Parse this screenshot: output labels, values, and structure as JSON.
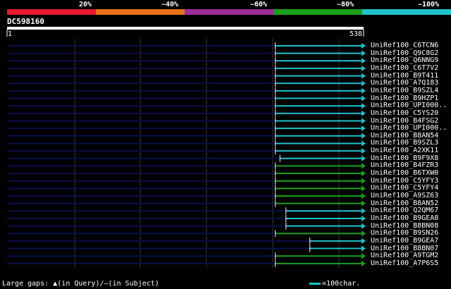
{
  "scale_labels": [
    "20%",
    "~40%",
    "~60%",
    "~80%",
    "~100%"
  ],
  "scale_colors": [
    "#e8162e",
    "#e8731a",
    "#9b2d9b",
    "#19a11b",
    "#1ec2c8"
  ],
  "query": {
    "name": "DC598160",
    "start": "1",
    "end": "538",
    "length": 538
  },
  "hits": [
    {
      "name": "UniRef100_C6TCN6",
      "start": 405,
      "end": 538,
      "identity_color": "#1ec2c8"
    },
    {
      "name": "UniRef100_Q9C8G2",
      "start": 405,
      "end": 538,
      "identity_color": "#1ec2c8"
    },
    {
      "name": "UniRef100_Q6NNG9",
      "start": 405,
      "end": 538,
      "identity_color": "#1ec2c8"
    },
    {
      "name": "UniRef100_C6T7V2",
      "start": 405,
      "end": 538,
      "identity_color": "#1ec2c8"
    },
    {
      "name": "UniRef100_B9T411",
      "start": 405,
      "end": 538,
      "identity_color": "#1ec2c8"
    },
    {
      "name": "UniRef100_A7Q183",
      "start": 405,
      "end": 538,
      "identity_color": "#1ec2c8"
    },
    {
      "name": "UniRef100_B9SZL4",
      "start": 405,
      "end": 538,
      "identity_color": "#1ec2c8"
    },
    {
      "name": "UniRef100_B9HZP1",
      "start": 405,
      "end": 538,
      "identity_color": "#1ec2c8"
    },
    {
      "name": "UniRef100_UPI000..",
      "start": 405,
      "end": 538,
      "identity_color": "#1ec2c8"
    },
    {
      "name": "UniRef100_C5YS20",
      "start": 405,
      "end": 538,
      "identity_color": "#1ec2c8"
    },
    {
      "name": "UniRef100_B4FSG2",
      "start": 405,
      "end": 538,
      "identity_color": "#1ec2c8"
    },
    {
      "name": "UniRef100_UPI000..",
      "start": 405,
      "end": 538,
      "identity_color": "#1ec2c8"
    },
    {
      "name": "UniRef100_B8AN54",
      "start": 405,
      "end": 538,
      "identity_color": "#1ec2c8"
    },
    {
      "name": "UniRef100_B9SZL3",
      "start": 405,
      "end": 538,
      "identity_color": "#1ec2c8"
    },
    {
      "name": "UniRef100_A2XK11",
      "start": 405,
      "end": 538,
      "identity_color": "#1ec2c8"
    },
    {
      "name": "UniRef100_B9F9X8",
      "start": 412,
      "end": 538,
      "identity_color": "#1ec2c8"
    },
    {
      "name": "UniRef100_B4FZR3",
      "start": 405,
      "end": 538,
      "identity_color": "#19a11b"
    },
    {
      "name": "UniRef100_B6TXW0",
      "start": 405,
      "end": 538,
      "identity_color": "#19a11b"
    },
    {
      "name": "UniRef100_C5YFY3",
      "start": 405,
      "end": 538,
      "identity_color": "#19a11b"
    },
    {
      "name": "UniRef100_C5YFY4",
      "start": 405,
      "end": 538,
      "identity_color": "#19a11b"
    },
    {
      "name": "UniRef100_A9SZ63",
      "start": 405,
      "end": 538,
      "identity_color": "#19a11b"
    },
    {
      "name": "UniRef100_B8AN52",
      "start": 405,
      "end": 538,
      "identity_color": "#19a11b"
    },
    {
      "name": "UniRef100_Q2QM67",
      "start": 421,
      "end": 538,
      "identity_color": "#1ec2c8"
    },
    {
      "name": "UniRef100_B9GEA8",
      "start": 421,
      "end": 538,
      "identity_color": "#1ec2c8"
    },
    {
      "name": "UniRef100_B8BN08",
      "start": 421,
      "end": 538,
      "identity_color": "#1ec2c8"
    },
    {
      "name": "UniRef100_B9SN26",
      "start": 405,
      "end": 538,
      "identity_color": "#19a11b"
    },
    {
      "name": "UniRef100_B9GEA7",
      "start": 457,
      "end": 538,
      "identity_color": "#1ec2c8"
    },
    {
      "name": "UniRef100_B8BN07",
      "start": 457,
      "end": 538,
      "identity_color": "#1ec2c8"
    },
    {
      "name": "UniRef100_A9TGM2",
      "start": 405,
      "end": 538,
      "identity_color": "#19a11b"
    },
    {
      "name": "UniRef100_A7P6S5",
      "start": 405,
      "end": 538,
      "identity_color": "#19a11b"
    }
  ],
  "legend": {
    "gaps_prefix": "Large gaps: ",
    "gaps_query_label": "(in Query)/",
    "gaps_subject_dash": "—",
    "gaps_subject_label": "(in Subject)",
    "scale_text": "=100char."
  },
  "colors": {
    "background": "#000000",
    "query_line": "#0a0f4a",
    "grid": "#3a3a3a",
    "ruler": "#ffffff"
  }
}
